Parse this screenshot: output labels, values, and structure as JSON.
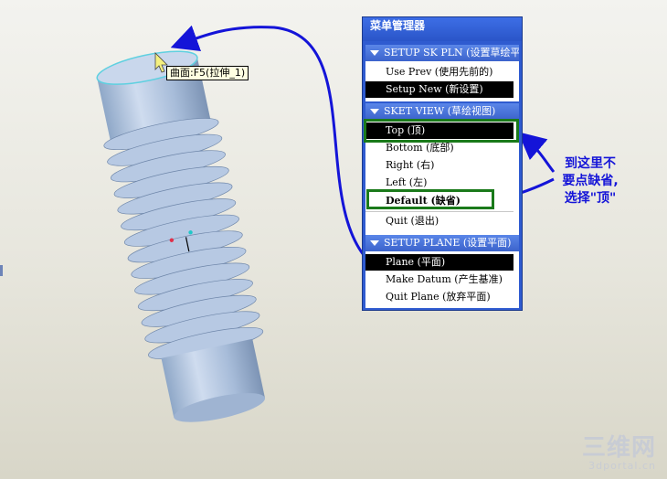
{
  "tooltip": "曲面:F5(拉伸_1)",
  "menu_manager": {
    "title": "菜单管理器",
    "sections": [
      {
        "heading": "SETUP SK PLN (设置草绘平面)",
        "items": [
          {
            "label": "Use Prev (使用先前的)",
            "selected": false
          },
          {
            "label": "Setup New (新设置)",
            "selected": true
          }
        ]
      },
      {
        "heading": "SKET VIEW (草绘视图)",
        "items": [
          {
            "label": "Top (顶)",
            "selected": true
          },
          {
            "label": "Bottom (底部)",
            "selected": false
          },
          {
            "label": "Right (右)",
            "selected": false
          },
          {
            "label": "Left (左)",
            "selected": false
          },
          {
            "label": "Default (缺省)",
            "selected": false
          },
          {
            "label": "Quit (退出)",
            "selected": false
          }
        ]
      },
      {
        "heading": "SETUP PLANE (设置平面)",
        "items": [
          {
            "label": "Plane (平面)",
            "selected": true
          },
          {
            "label": "Make Datum (产生基准)",
            "selected": false
          },
          {
            "label": "Quit Plane (放弃平面)",
            "selected": false
          }
        ]
      }
    ]
  },
  "annotation": {
    "line1": "到这里不",
    "line2": "要点缺省,",
    "line3": "选择\"顶\""
  },
  "watermark": {
    "name": "三维网",
    "domain": "3dportal.cn"
  },
  "colors": {
    "arrow": "#1414d8",
    "highlight_box": "#1a7a1a",
    "menu_frame": "#2f5bd0"
  }
}
